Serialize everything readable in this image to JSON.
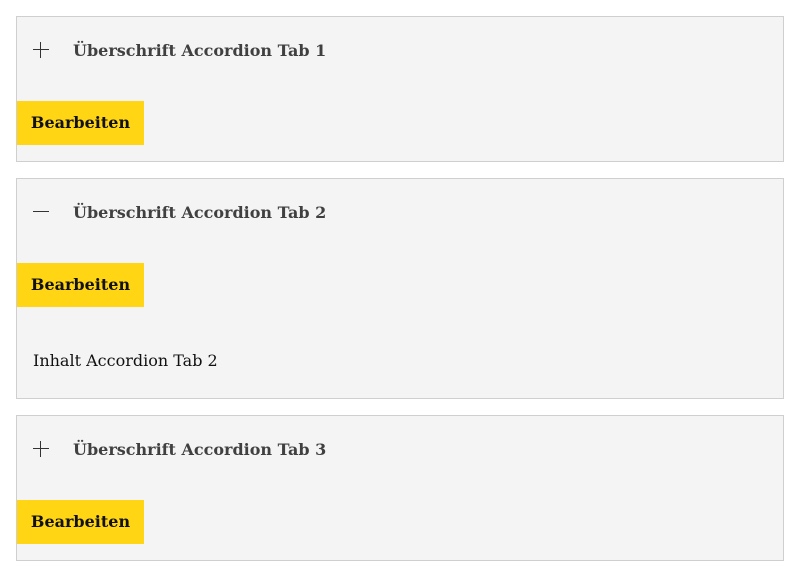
{
  "accordion": {
    "tabs": [
      {
        "title": "Überschrift Accordion Tab 1",
        "expanded": false,
        "icon": "plus-icon",
        "edit_label": "Bearbeiten",
        "content": ""
      },
      {
        "title": "Überschrift Accordion Tab 2",
        "expanded": true,
        "icon": "minus-icon",
        "edit_label": "Bearbeiten",
        "content": "Inhalt Accordion Tab 2"
      },
      {
        "title": "Überschrift Accordion Tab 3",
        "expanded": false,
        "icon": "plus-icon",
        "edit_label": "Bearbeiten",
        "content": ""
      }
    ]
  },
  "colors": {
    "panel_background": "#f4f4f4",
    "panel_border": "#cfcfcf",
    "button_accent": "#ffd514",
    "title_text": "#404040",
    "body_text": "#111111"
  }
}
